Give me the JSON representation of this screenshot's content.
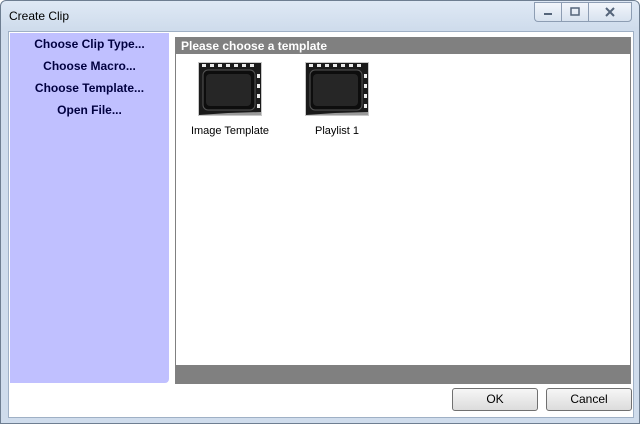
{
  "window": {
    "title": "Create Clip"
  },
  "sidebar": {
    "steps": [
      {
        "label": "Choose Clip Type..."
      },
      {
        "label": "Choose Macro..."
      },
      {
        "label": "Choose Template..."
      },
      {
        "label": "Open File..."
      }
    ]
  },
  "panel": {
    "header": "Please choose a template",
    "templates": [
      {
        "label": "Image Template",
        "icon": "film-frame-icon"
      },
      {
        "label": "Playlist 1",
        "icon": "film-frame-icon"
      }
    ]
  },
  "buttons": {
    "ok": "OK",
    "cancel": "Cancel"
  },
  "colors": {
    "sidebar_bg": "#c0c0ff",
    "header_bg": "#808080",
    "sidebar_text": "#000040"
  }
}
